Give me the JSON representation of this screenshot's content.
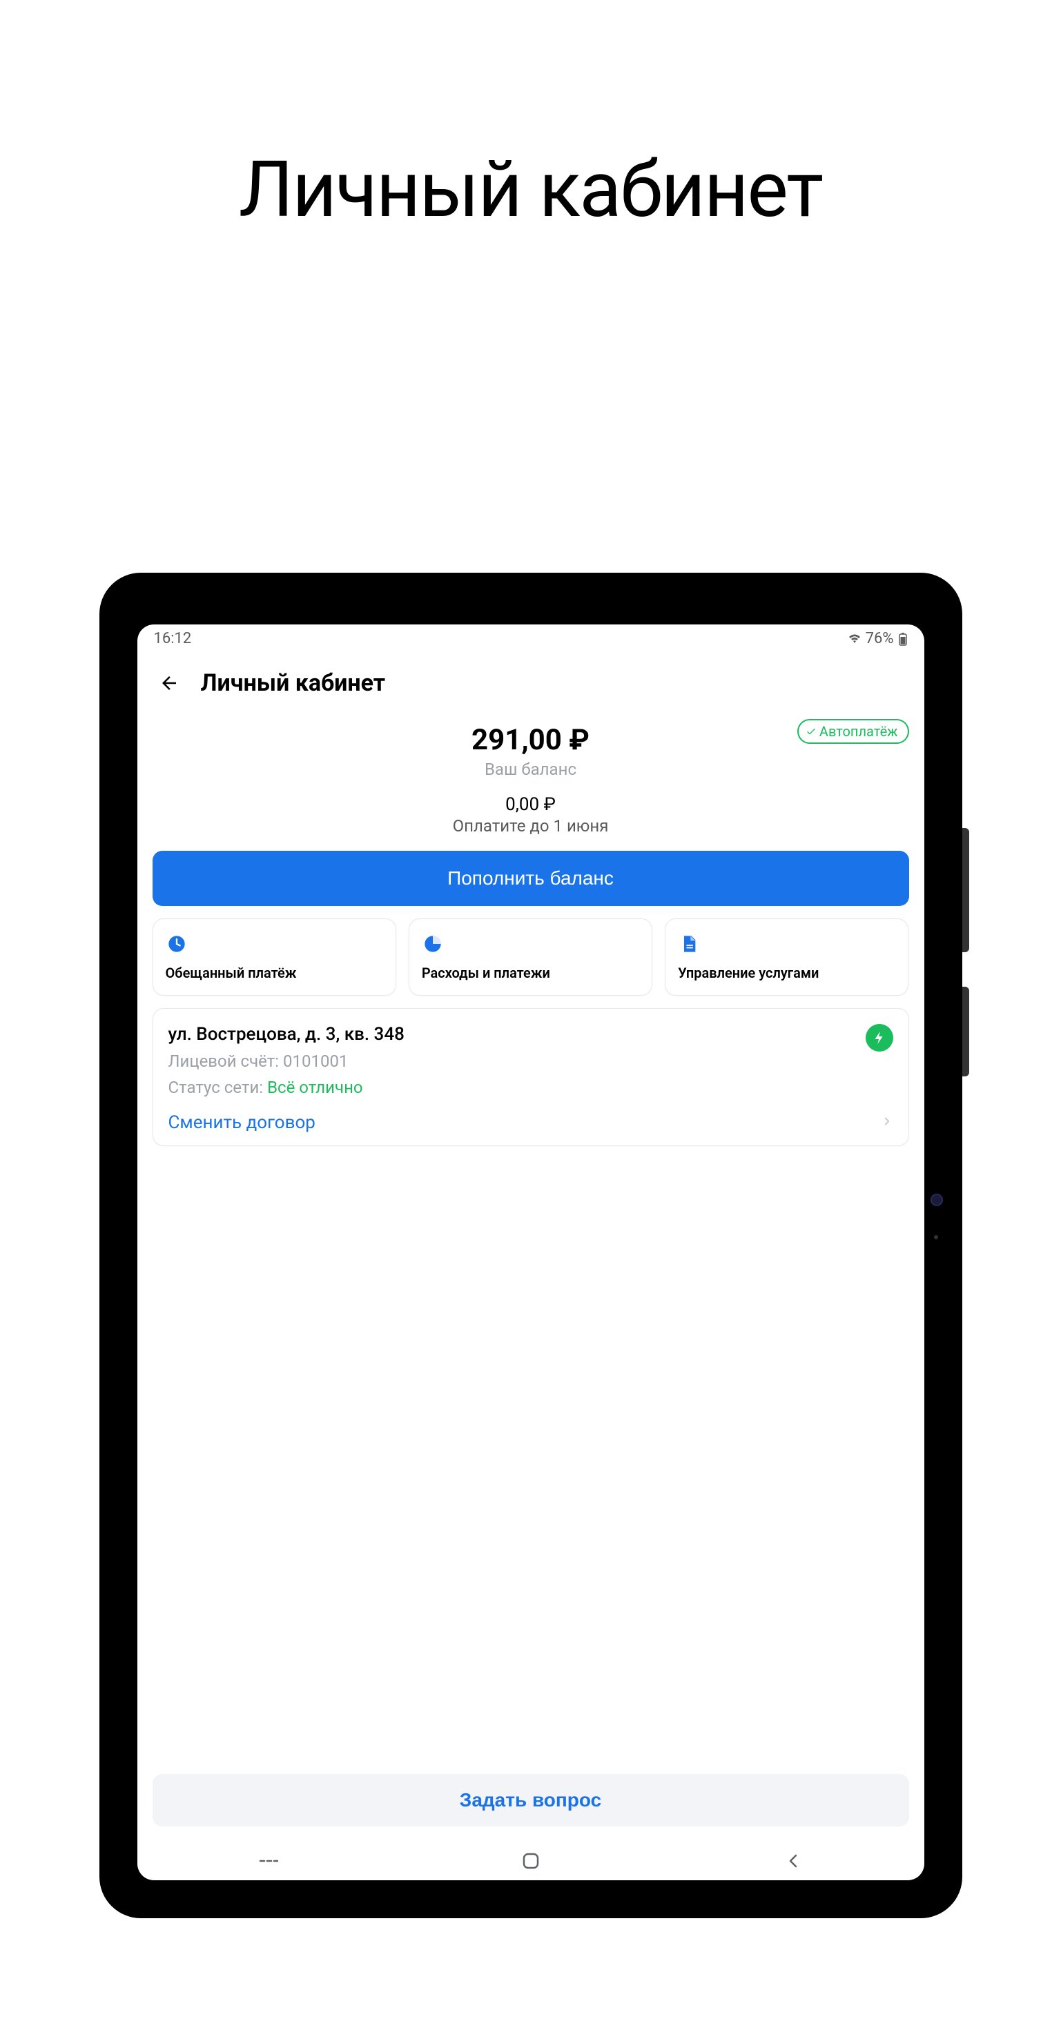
{
  "page_title": "Личный кабинет",
  "statusbar": {
    "time": "16:12",
    "battery_pct": "76%"
  },
  "header": {
    "title": "Личный кабинет"
  },
  "balance": {
    "amount": "291,00 ₽",
    "label": "Ваш баланс",
    "autopay_badge": "Автоплатёж"
  },
  "due": {
    "amount": "0,00 ₽",
    "label": "Оплатите до 1 июня"
  },
  "topup_button": "Пополнить баланс",
  "actions": {
    "promised": {
      "label": "Обещанный платёж"
    },
    "expenses": {
      "label": "Расходы и платежи"
    },
    "services": {
      "label": "Управление услугами"
    }
  },
  "account": {
    "address": "ул. Вострецова, д. 3, кв. 348",
    "number_label": "Лицевой счёт: 0101001",
    "status_label": "Статус сети:  ",
    "status_value": "Всё отлично",
    "change_contract": "Сменить договор"
  },
  "ask_button": "Задать вопрос"
}
